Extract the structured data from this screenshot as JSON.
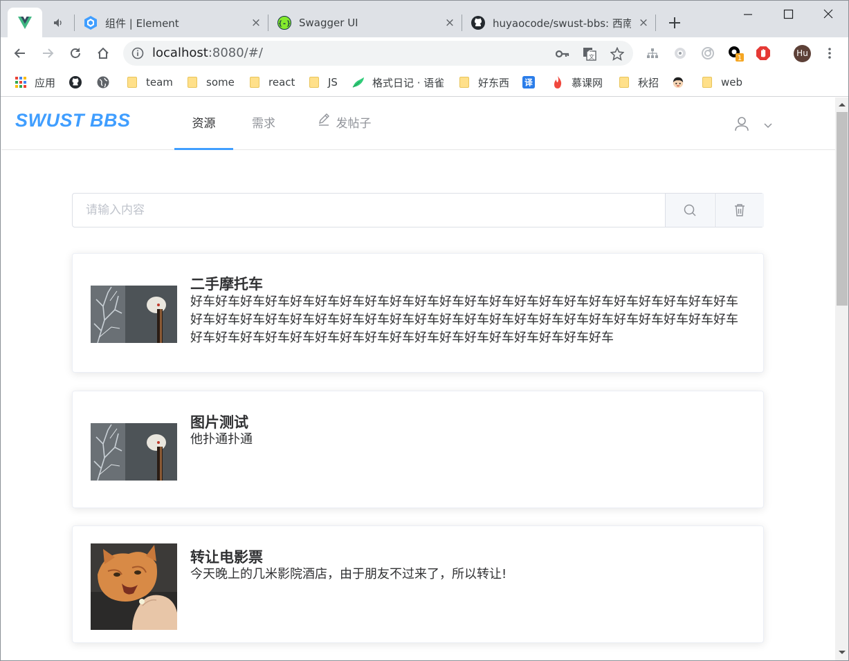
{
  "browser": {
    "tabs": [
      {
        "title": "",
        "favicon": "vue-icon",
        "active": true
      },
      {
        "title": "",
        "favicon": "speaker-mute-icon"
      },
      {
        "title": "组件 | Element",
        "favicon": "element-icon"
      },
      {
        "title": "Swagger UI",
        "favicon": "swagger-icon"
      },
      {
        "title": "huyaocode/swust-bbs: 西南",
        "favicon": "github-icon"
      }
    ],
    "url_host": "localhost",
    "url_rest": ":8080/#/",
    "profile_initials": "Hu",
    "extension_badge": "1",
    "bookmarks": [
      "应用",
      "",
      "",
      "team",
      "some",
      "react",
      "JS",
      "格式日记 · 语雀",
      "好东西",
      "",
      "慕课网",
      "秋招",
      "",
      "web"
    ]
  },
  "app": {
    "logo": "SWUST BBS",
    "nav": [
      "资源",
      "需求",
      "发帖子"
    ],
    "active_nav": "资源",
    "search_placeholder": "请输入内容"
  },
  "posts": [
    {
      "title": "二手摩托车",
      "body": "好车好车好车好车好车好车好车好车好车好车好车好车好车好车好车好车好车好车好车好车好车好车好车好车好车好车好车好车好车好车好车好车好车好车好车好车好车好车好车好车好车好车好车好车好车好车好车好车好车好车好车好车好车好车好车好车好车好车好车好车好车",
      "image": "branch-photo"
    },
    {
      "title": "图片测试",
      "body": "他扑通扑通",
      "image": "branch-photo"
    },
    {
      "title": "转让电影票",
      "body": "今天晚上的几米影院酒店，由于朋友不过来了，所以转让!",
      "image": "cat-photo"
    }
  ],
  "colors": {
    "accent": "#409eff",
    "text": "#303133",
    "muted": "#909399"
  }
}
